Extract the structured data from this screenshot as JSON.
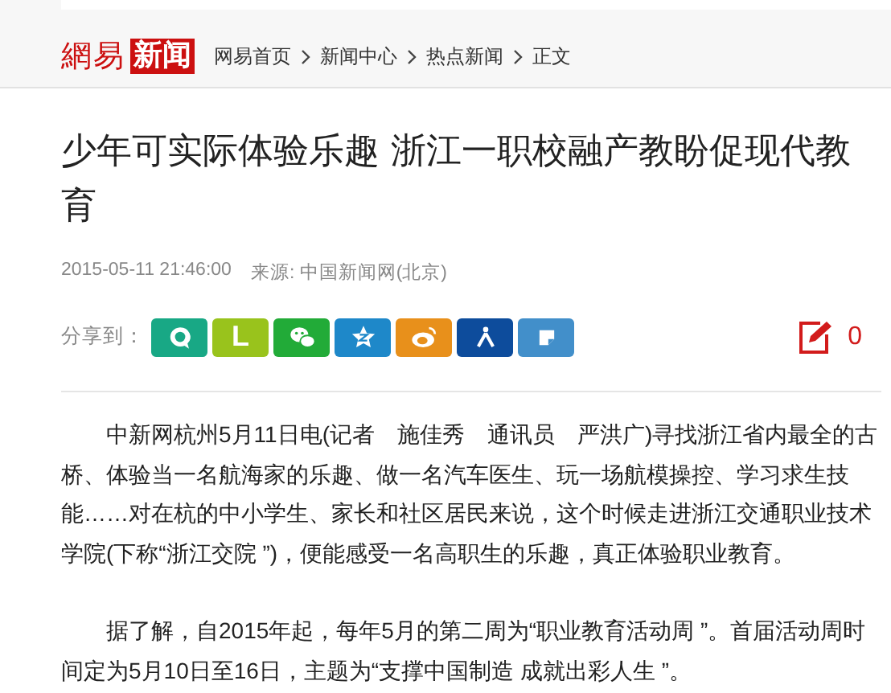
{
  "header": {
    "logo": {
      "brand": "網易",
      "section": "新闻"
    },
    "breadcrumb": [
      {
        "label": "网易首页"
      },
      {
        "label": "新闻中心"
      },
      {
        "label": "热点新闻"
      },
      {
        "label": "正文"
      }
    ]
  },
  "article": {
    "title": "少年可实际体验乐趣  浙江一职校融产教盼促现代教育",
    "date": "2015-05-11 21:46:00",
    "source": "来源: 中国新闻网(北京)",
    "share_label": "分享到：",
    "share": [
      {
        "kind": "bubble",
        "color": "#18a885"
      },
      {
        "kind": "letter",
        "label": "L",
        "color": "#99c31c"
      },
      {
        "kind": "chat",
        "color": "#22ab38"
      },
      {
        "kind": "star",
        "color": "#1e88c9"
      },
      {
        "kind": "eye",
        "color": "#e8901b"
      },
      {
        "kind": "person",
        "color": "#0d4c9c"
      },
      {
        "kind": "note",
        "color": "#428fca"
      }
    ],
    "comment_count": "0",
    "paragraphs": [
      "中新网杭州5月11日电(记者　施佳秀　通讯员　严洪广)寻找浙江省内最全的古桥、体验当一名航海家的乐趣、做一名汽车医生、玩一场航模操控、学习求生技能……对在杭的中小学生、家长和社区居民来说，这个时候走进浙江交通职业技术学院(下称“浙江交院 ”)，便能感受一名高职生的乐趣，真正体验职业教育。",
      "据了解，自2015年起，每年5月的第二周为“职业教育活动周 ”。首届活动周时间定为5月10日至16日，主题为“支撑中国制造 成就出彩人生 ”。"
    ]
  }
}
